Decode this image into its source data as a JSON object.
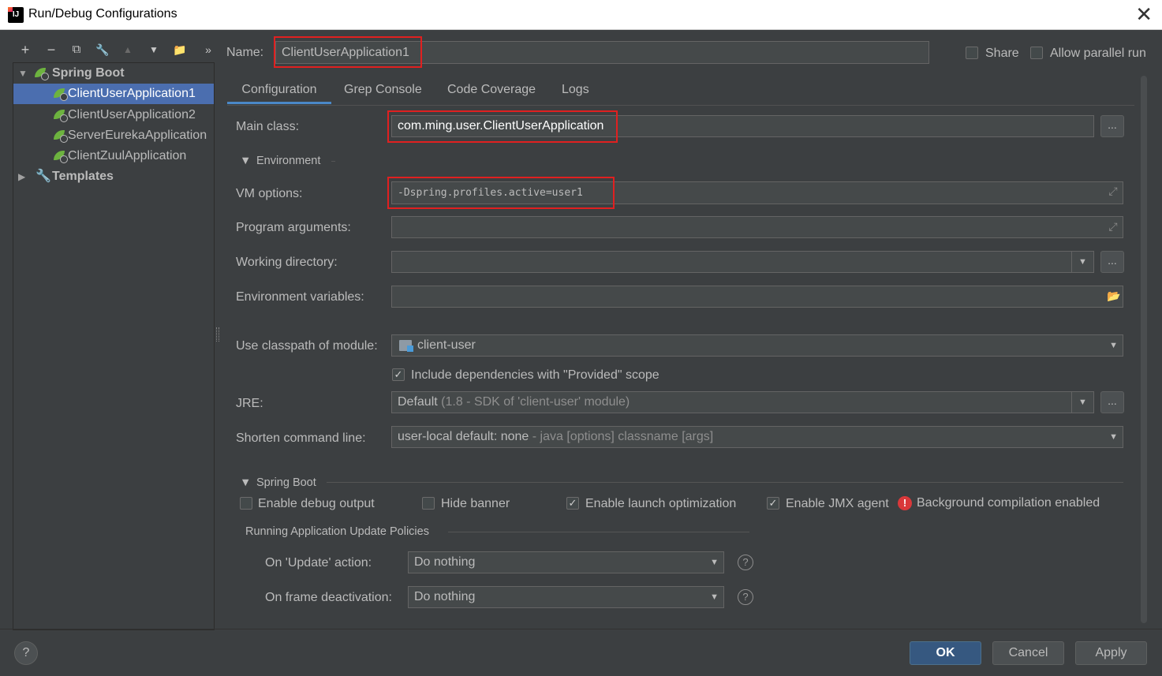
{
  "window": {
    "title": "Run/Debug Configurations",
    "app_icon_text": "IJ"
  },
  "toolbar": {
    "add": "+",
    "remove": "−",
    "copy": "⧉",
    "edit_defaults": "🔧",
    "move_up": "▲",
    "move_down": "▼",
    "folder": "📁",
    "more": "»"
  },
  "tree": {
    "group": "Spring Boot",
    "items": [
      "ClientUserApplication1",
      "ClientUserApplication2",
      "ServerEurekaApplication",
      "ClientZuulApplication"
    ],
    "templates": "Templates"
  },
  "header": {
    "name_label": "Name:",
    "name_value": "ClientUserApplication1",
    "share_label": "Share",
    "allow_parallel_label": "Allow parallel run"
  },
  "tabs": [
    "Configuration",
    "Grep Console",
    "Code Coverage",
    "Logs"
  ],
  "config": {
    "main_class_label": "Main class:",
    "main_class_value": "com.ming.user.ClientUserApplication",
    "environment_section": "Environment",
    "vm_options_label": "VM options:",
    "vm_options_value": "-Dspring.profiles.active=user1",
    "program_args_label": "Program arguments:",
    "working_dir_label": "Working directory:",
    "env_vars_label": "Environment variables:",
    "classpath_label": "Use classpath of module:",
    "classpath_value": "client-user",
    "include_deps_label": "Include dependencies with \"Provided\" scope",
    "jre_label": "JRE:",
    "jre_value": "Default",
    "jre_detail": "(1.8 - SDK of 'client-user' module)",
    "shorten_label": "Shorten command line:",
    "shorten_value": "user-local default: none",
    "shorten_detail": "- java [options] classname [args]",
    "dots": "..."
  },
  "spring_boot": {
    "section": "Spring Boot",
    "debug_output": "Enable debug output",
    "hide_banner": "Hide banner",
    "launch_opt": "Enable launch optimization",
    "jmx_agent": "Enable JMX agent",
    "bg_compilation": "Background compilation enabled",
    "policies_title": "Running Application Update Policies",
    "on_update_label": "On 'Update' action:",
    "on_update_value": "Do nothing",
    "on_frame_label": "On frame deactivation:",
    "on_frame_value": "Do nothing"
  },
  "footer": {
    "help": "?",
    "ok": "OK",
    "cancel": "Cancel",
    "apply": "Apply"
  },
  "colors": {
    "background": "#3c3f41",
    "selection": "#4b6eaf",
    "highlight_box": "#e02020",
    "primary_button": "#365880",
    "spring_leaf": "#6db33f",
    "error": "#d9383a"
  }
}
